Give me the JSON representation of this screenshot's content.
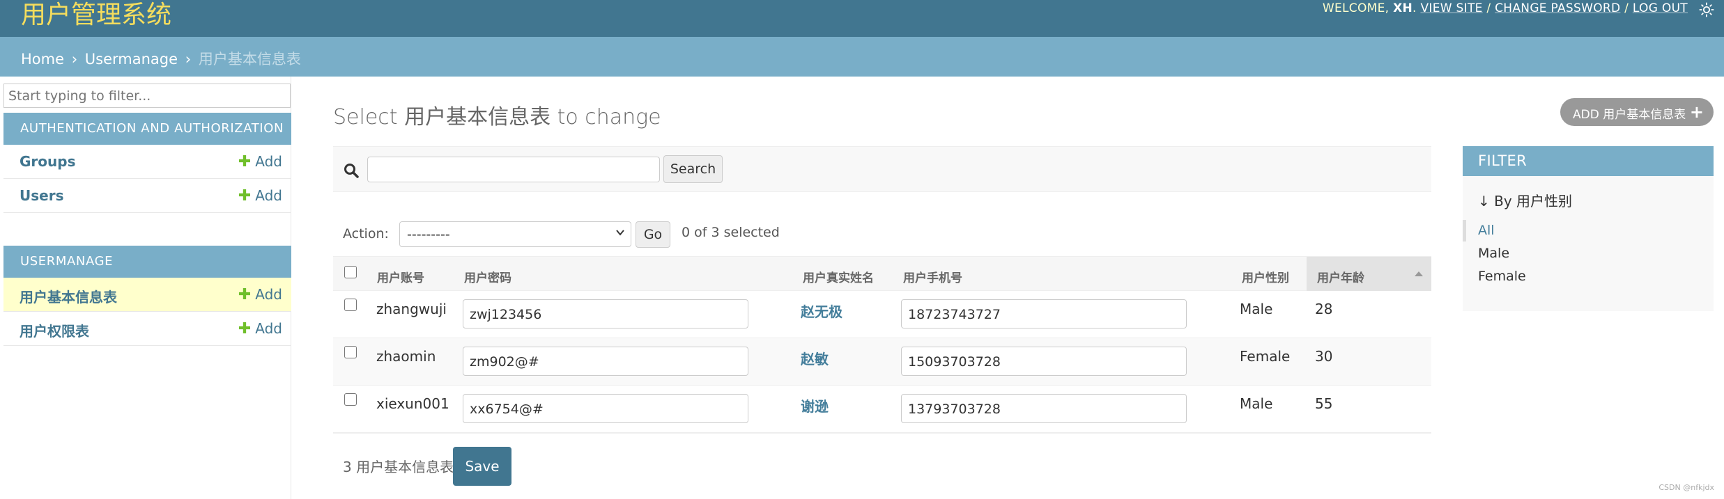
{
  "header": {
    "branding": "用户管理系统",
    "welcome": "WELCOME, ",
    "username": "XH",
    "links": {
      "view_site": "VIEW SITE",
      "change_password": "CHANGE PASSWORD",
      "log_out": "LOG OUT"
    },
    "sep": " / ",
    "theme_icon": "sun-icon"
  },
  "breadcrumbs": {
    "home": "Home",
    "sep": "›",
    "app": "Usermanage",
    "current": "用户基本信息表"
  },
  "sidebar": {
    "filter_placeholder": "Start typing to filter...",
    "apps": [
      {
        "caption": "AUTHENTICATION AND AUTHORIZATION",
        "models": [
          {
            "label": "Groups",
            "add": "Add"
          },
          {
            "label": "Users",
            "add": "Add"
          }
        ]
      },
      {
        "caption": "USERMANAGE",
        "models": [
          {
            "label": "用户基本信息表",
            "add": "Add",
            "current": true
          },
          {
            "label": "用户权限表",
            "add": "Add"
          }
        ]
      }
    ]
  },
  "main": {
    "title": "Select 用户基本信息表 to change",
    "add_button": "ADD 用户基本信息表",
    "search": {
      "button": "Search",
      "value": ""
    },
    "actions": {
      "label": "Action:",
      "selected": "---------",
      "go": "Go",
      "counter": "0 of 3 selected"
    },
    "table": {
      "headers": [
        "用户账号",
        "用户密码",
        "用户真实姓名",
        "用户手机号",
        "用户性别",
        "用户年龄"
      ],
      "rows": [
        {
          "account": "zhangwuji",
          "password": "zwj123456",
          "real_name": "赵无极",
          "phone": "18723743727",
          "gender": "Male",
          "age": "28"
        },
        {
          "account": "zhaomin",
          "password": "zm902@#",
          "real_name": "赵敏",
          "phone": "15093703728",
          "gender": "Female",
          "age": "30"
        },
        {
          "account": "xiexun001",
          "password": "xx6754@#",
          "real_name": "谢逊",
          "phone": "13793703728",
          "gender": "Male",
          "age": "55"
        }
      ]
    },
    "paginator": {
      "count": "3 用户基本信息表",
      "save": "Save"
    }
  },
  "filter": {
    "title": "FILTER",
    "heading": "↓ By 用户性别",
    "options": [
      "All",
      "Male",
      "Female"
    ],
    "selected": "All"
  },
  "watermark": "CSDN @nfkjdx",
  "colors": {
    "header": "#417690",
    "module": "#79aec8",
    "branding": "#f5dd5d",
    "link": "#447e9b",
    "add_green": "#70bf2b",
    "current_model": "#ffffcc"
  }
}
